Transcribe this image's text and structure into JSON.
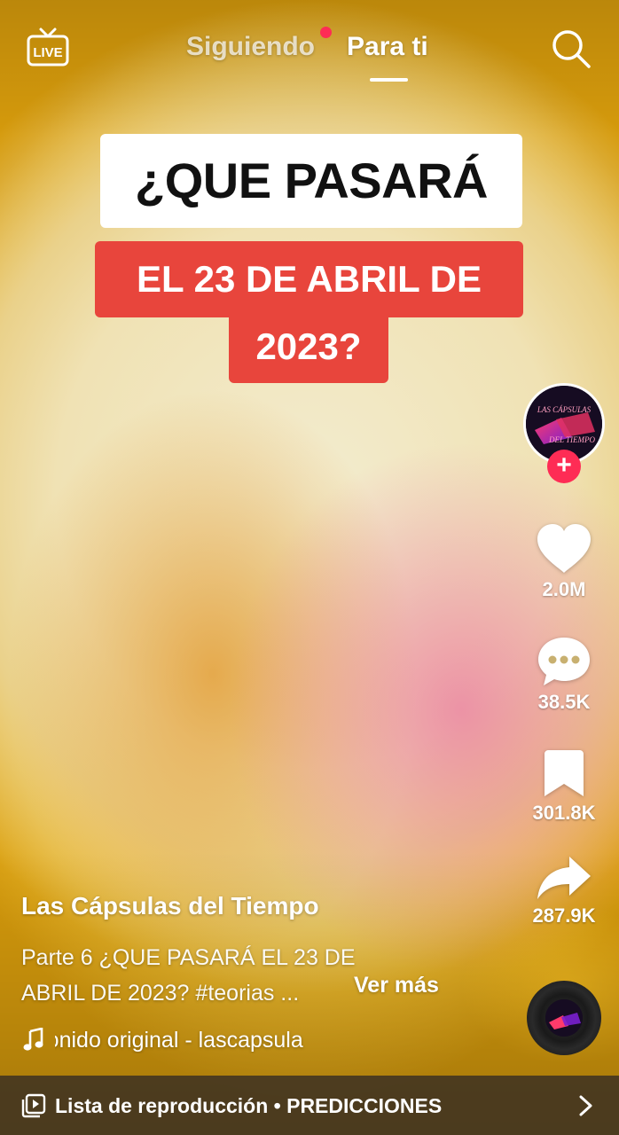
{
  "header": {
    "live_label": "LIVE",
    "tabs": [
      {
        "label": "Siguiendo",
        "active": false,
        "has_notification": true
      },
      {
        "label": "Para ti",
        "active": true
      }
    ],
    "icons": {
      "live": "live-tv-icon",
      "search": "search-icon"
    }
  },
  "video": {
    "caption_lines": [
      "¿QUE PASARÁ",
      "EL 23 DE ABRIL DE",
      "2023?"
    ],
    "avatar_text": [
      "LAS CÁPSULAS",
      "DEL TIEMPO"
    ]
  },
  "actions": {
    "likes": "2.0M",
    "comments": "38.5K",
    "saves": "301.8K",
    "shares": "287.9K",
    "icons": {
      "like": "heart-icon",
      "comment": "comment-bubble-icon",
      "save": "bookmark-icon",
      "share": "share-arrow-icon",
      "follow": "plus-icon"
    }
  },
  "info": {
    "author": "Las Cápsulas del Tiempo",
    "description_lines": [
      "Parte 6  ¿QUE PASARÁ EL 23 DE",
      "ABRIL DE 2023? #teorias ..."
    ],
    "more_label": "Ver más",
    "sound": "Sonido original - lascapsula"
  },
  "playlist": {
    "label": "Lista de reproducción • PREDICCIONES"
  },
  "colors": {
    "accent": "#fe2c55",
    "caption_red": "#e8453c",
    "caption_white": "#ffffff"
  }
}
